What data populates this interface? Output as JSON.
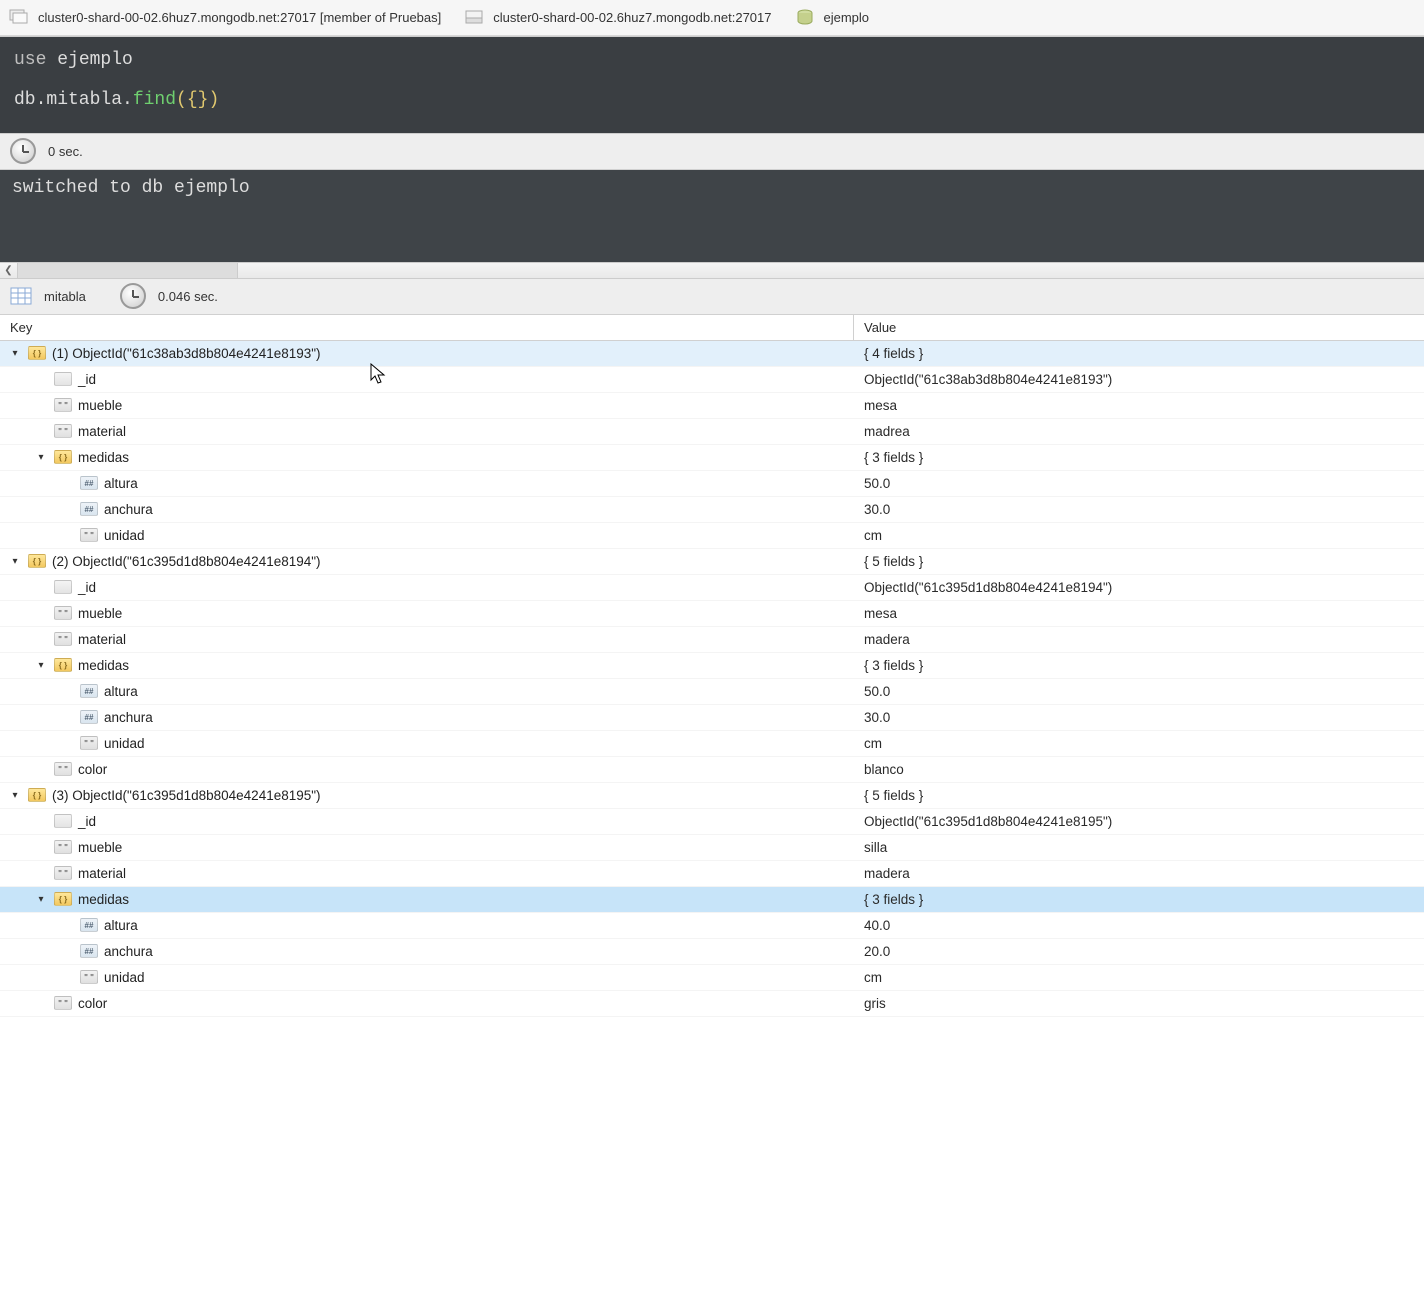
{
  "topbar": {
    "conn1": "cluster0-shard-00-02.6huz7.mongodb.net:27017 [member of Pruebas]",
    "conn2": "cluster0-shard-00-02.6huz7.mongodb.net:27017",
    "db": "ejemplo"
  },
  "code": {
    "line1_use": "use",
    "line1_db": "ejemplo",
    "line2_prefix": "db.mitabla.",
    "line2_fn": "find",
    "line2_open": "(",
    "line2_braces": "{}",
    "line2_close": ")"
  },
  "timebar": {
    "text": "0 sec."
  },
  "console": {
    "text": "switched to db ejemplo"
  },
  "resultbar": {
    "collection": "mitabla",
    "time": "0.046 sec."
  },
  "headers": {
    "key": "Key",
    "value": "Value"
  },
  "rows": [
    {
      "indent": 0,
      "toggle": "▼",
      "icon": "obj",
      "key": "(1) ObjectId(\"61c38ab3d8b804e4241e8193\")",
      "value": "{ 4 fields }",
      "sel": true
    },
    {
      "indent": 1,
      "toggle": "",
      "icon": "oid",
      "key": "_id",
      "value": "ObjectId(\"61c38ab3d8b804e4241e8193\")"
    },
    {
      "indent": 1,
      "toggle": "",
      "icon": "str",
      "key": "mueble",
      "value": "mesa"
    },
    {
      "indent": 1,
      "toggle": "",
      "icon": "str",
      "key": "material",
      "value": "madrea"
    },
    {
      "indent": 1,
      "toggle": "▼",
      "icon": "obj",
      "key": "medidas",
      "value": "{ 3 fields }"
    },
    {
      "indent": 2,
      "toggle": "",
      "icon": "num",
      "key": "altura",
      "value": "50.0"
    },
    {
      "indent": 2,
      "toggle": "",
      "icon": "num",
      "key": "anchura",
      "value": "30.0"
    },
    {
      "indent": 2,
      "toggle": "",
      "icon": "str",
      "key": "unidad",
      "value": "cm"
    },
    {
      "indent": 0,
      "toggle": "▼",
      "icon": "obj",
      "key": "(2) ObjectId(\"61c395d1d8b804e4241e8194\")",
      "value": "{ 5 fields }"
    },
    {
      "indent": 1,
      "toggle": "",
      "icon": "oid",
      "key": "_id",
      "value": "ObjectId(\"61c395d1d8b804e4241e8194\")"
    },
    {
      "indent": 1,
      "toggle": "",
      "icon": "str",
      "key": "mueble",
      "value": "mesa"
    },
    {
      "indent": 1,
      "toggle": "",
      "icon": "str",
      "key": "material",
      "value": "madera"
    },
    {
      "indent": 1,
      "toggle": "▼",
      "icon": "obj",
      "key": "medidas",
      "value": "{ 3 fields }"
    },
    {
      "indent": 2,
      "toggle": "",
      "icon": "num",
      "key": "altura",
      "value": "50.0"
    },
    {
      "indent": 2,
      "toggle": "",
      "icon": "num",
      "key": "anchura",
      "value": "30.0"
    },
    {
      "indent": 2,
      "toggle": "",
      "icon": "str",
      "key": "unidad",
      "value": "cm"
    },
    {
      "indent": 1,
      "toggle": "",
      "icon": "str",
      "key": "color",
      "value": "blanco"
    },
    {
      "indent": 0,
      "toggle": "▼",
      "icon": "obj",
      "key": "(3) ObjectId(\"61c395d1d8b804e4241e8195\")",
      "value": "{ 5 fields }"
    },
    {
      "indent": 1,
      "toggle": "",
      "icon": "oid",
      "key": "_id",
      "value": "ObjectId(\"61c395d1d8b804e4241e8195\")"
    },
    {
      "indent": 1,
      "toggle": "",
      "icon": "str",
      "key": "mueble",
      "value": "silla"
    },
    {
      "indent": 1,
      "toggle": "",
      "icon": "str",
      "key": "material",
      "value": "madera"
    },
    {
      "indent": 1,
      "toggle": "▼",
      "icon": "obj",
      "key": "medidas",
      "value": "{ 3 fields }",
      "hov": true
    },
    {
      "indent": 2,
      "toggle": "",
      "icon": "num",
      "key": "altura",
      "value": "40.0"
    },
    {
      "indent": 2,
      "toggle": "",
      "icon": "num",
      "key": "anchura",
      "value": "20.0"
    },
    {
      "indent": 2,
      "toggle": "",
      "icon": "str",
      "key": "unidad",
      "value": "cm"
    },
    {
      "indent": 1,
      "toggle": "",
      "icon": "str",
      "key": "color",
      "value": "gris"
    }
  ]
}
